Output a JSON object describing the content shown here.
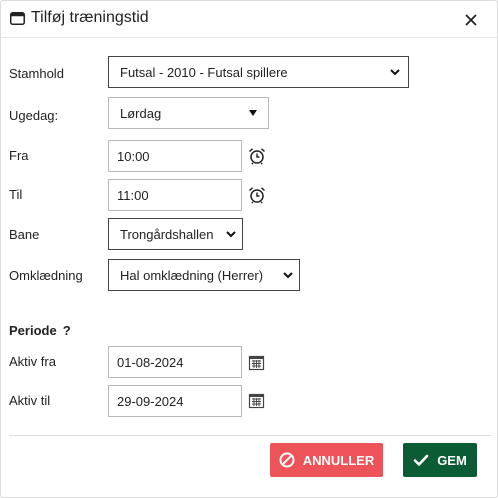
{
  "dialog": {
    "title": "Tilføj træningstid",
    "icon": "window-icon",
    "close_icon": "close-icon"
  },
  "form": {
    "stamhold": {
      "label": "Stamhold",
      "value": "Futsal - 2010 - Futsal spillere"
    },
    "ugedag": {
      "label": "Ugedag:",
      "value": "Lørdag"
    },
    "fra": {
      "label": "Fra",
      "value": "10:00",
      "icon": "alarm-clock-icon"
    },
    "til": {
      "label": "Til",
      "value": "11:00",
      "icon": "alarm-clock-icon"
    },
    "bane": {
      "label": "Bane",
      "value": "Trongårdshallen"
    },
    "omklaedning": {
      "label": "Omklædning",
      "value": "Hal omklædning (Herrer)"
    }
  },
  "periode": {
    "title": "Periode",
    "help": "?",
    "aktiv_fra": {
      "label": "Aktiv fra",
      "value": "01-08-2024",
      "icon": "calendar-icon"
    },
    "aktiv_til": {
      "label": "Aktiv til",
      "value": "29-09-2024",
      "icon": "calendar-icon"
    }
  },
  "actions": {
    "cancel_label": "ANNULLER",
    "save_label": "GEM"
  },
  "colors": {
    "cancel": "#ec5459",
    "save": "#0b5c34"
  }
}
